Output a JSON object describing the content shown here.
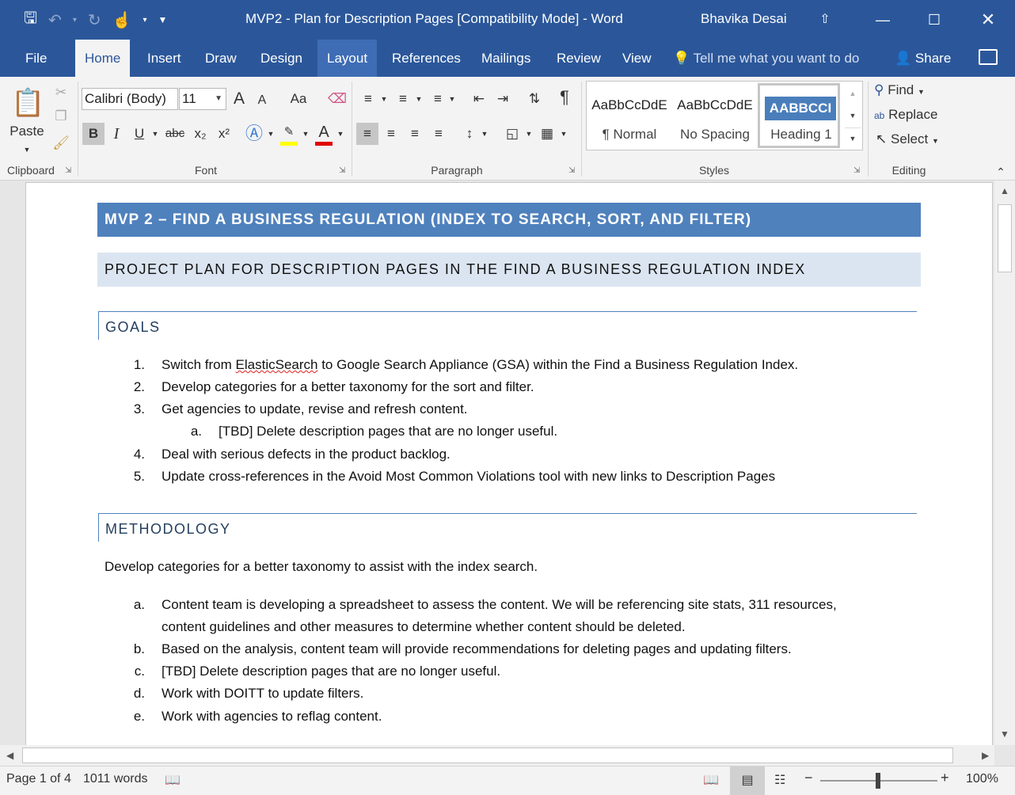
{
  "titlebar": {
    "title": "MVP2 - Plan for Description Pages [Compatibility Mode] - Word",
    "user": "Bhavika Desai",
    "qat_icons": [
      "save-icon",
      "undo-icon",
      "redo-icon",
      "touch-mode-icon",
      "customize-icon"
    ]
  },
  "tabs": [
    "File",
    "Home",
    "Insert",
    "Draw",
    "Design",
    "Layout",
    "References",
    "Mailings",
    "Review",
    "View"
  ],
  "active_tab": "Home",
  "tell_me": "Tell me what you want to do",
  "share": "Share",
  "ribbon": {
    "clipboard": {
      "paste": "Paste",
      "label": "Clipboard"
    },
    "font": {
      "name": "Calibri (Body)",
      "size": "11",
      "label": "Font",
      "bold": "B",
      "italic": "I",
      "underline": "U",
      "strike": "abc",
      "subscript": "x₂",
      "superscript": "x²",
      "grow": "A",
      "shrink": "A",
      "case": "Aa",
      "color_letter": "A",
      "highlight_color": "#ffff00",
      "font_color": "#e00000"
    },
    "paragraph": {
      "label": "Paragraph",
      "pilcrow": "¶"
    },
    "styles": {
      "label": "Styles",
      "items": [
        {
          "sample": "AaBbCcDdE",
          "name": "¶ Normal"
        },
        {
          "sample": "AaBbCcDdE",
          "name": "No Spacing"
        },
        {
          "sample": "AABBCCI",
          "name": "Heading 1"
        }
      ]
    },
    "editing": {
      "label": "Editing",
      "find": "Find",
      "replace": "Replace",
      "select": "Select"
    }
  },
  "document": {
    "title": "MVP 2 – FIND A BUSINESS REGULATION (INDEX TO SEARCH, SORT, AND FILTER)",
    "subtitle": "PROJECT PLAN FOR DESCRIPTION PAGES IN THE FIND A BUSINESS REGULATION INDEX",
    "goals_heading": "GOALS",
    "goals": [
      {
        "num": "1.",
        "pre": "Switch from ",
        "squiggle": "ElasticSearch",
        "post": " to Google Search Appliance (GSA) within the Find a Business Regulation Index."
      },
      {
        "num": "2.",
        "text": "Develop categories for a better taxonomy for the sort and filter."
      },
      {
        "num": "3.",
        "text": "Get agencies to update, revise and refresh content."
      },
      {
        "num": "a.",
        "text": "[TBD] Delete description pages that are no longer useful."
      },
      {
        "num": "4.",
        "text": "Deal with serious defects in the product backlog."
      },
      {
        "num": "5.",
        "text": "Update cross-references in the Avoid Most Common Violations tool with new links to Description Pages"
      }
    ],
    "methodology_heading": "METHODOLOGY",
    "methodology_intro": "Develop categories for a better taxonomy to assist with the index search.",
    "methodology_items": [
      {
        "num": "a.",
        "line1": "Content team is developing a spreadsheet to assess the content.  We will be referencing site stats, 311 resources,",
        "line2": "content guidelines and other measures to determine whether content should be deleted."
      },
      {
        "num": "b.",
        "line1": "Based on the analysis, content team will provide recommendations for deleting pages and updating filters."
      },
      {
        "num": "c.",
        "line1": "[TBD] Delete description pages that are no longer useful."
      },
      {
        "num": "d.",
        "line1": "Work with DOITT to update filters."
      },
      {
        "num": "e.",
        "line1": "Work with agencies to reflag content."
      }
    ]
  },
  "status": {
    "page": "Page 1 of 4",
    "words": "1011 words",
    "zoom": "100%"
  }
}
